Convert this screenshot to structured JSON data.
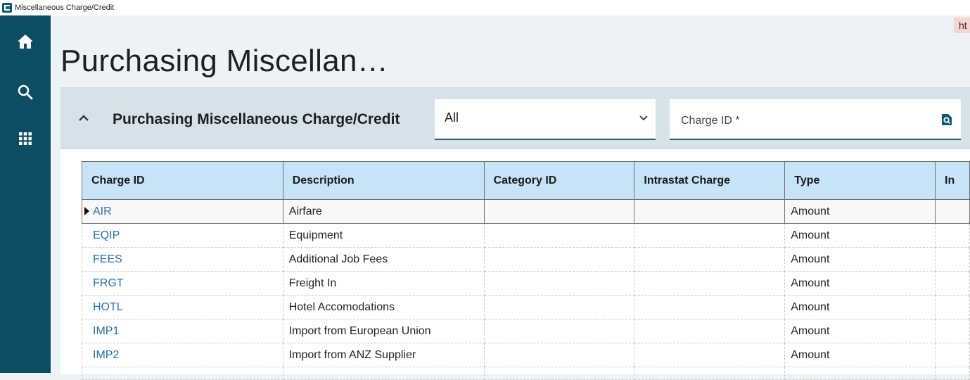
{
  "window": {
    "title": "Miscellaneous Charge/Credit"
  },
  "nav": {
    "items": [
      {
        "name": "home",
        "icon": "home-icon"
      },
      {
        "name": "search",
        "icon": "search-icon"
      },
      {
        "name": "apps",
        "icon": "apps-grid-icon"
      }
    ]
  },
  "url_chip": "ht",
  "page": {
    "title": "Purchasing Miscellan…"
  },
  "panel": {
    "title": "Purchasing Miscellaneous Charge/Credit",
    "filter": {
      "value": "All"
    },
    "search": {
      "placeholder": "Charge ID *"
    }
  },
  "grid": {
    "columns": [
      "Charge ID",
      "Description",
      "Category ID",
      "Intrastat Charge",
      "Type",
      "In"
    ],
    "rows": [
      {
        "id": "AIR",
        "description": "Airfare",
        "category": "",
        "intrastat": "",
        "type": "Amount"
      },
      {
        "id": "EQIP",
        "description": "Equipment",
        "category": "",
        "intrastat": "",
        "type": "Amount"
      },
      {
        "id": "FEES",
        "description": "Additional Job Fees",
        "category": "",
        "intrastat": "",
        "type": "Amount"
      },
      {
        "id": "FRGT",
        "description": "Freight In",
        "category": "",
        "intrastat": "",
        "type": "Amount"
      },
      {
        "id": "HOTL",
        "description": "Hotel Accomodations",
        "category": "",
        "intrastat": "",
        "type": "Amount"
      },
      {
        "id": "IMP1",
        "description": "Import from European Union",
        "category": "",
        "intrastat": "",
        "type": "Amount"
      },
      {
        "id": "IMP2",
        "description": "Import from ANZ Supplier",
        "category": "",
        "intrastat": "",
        "type": "Amount"
      }
    ]
  },
  "colors": {
    "nav": "#0c4d63",
    "header": "#d6e2e7",
    "grid_header": "#c6e3f7",
    "link": "#2a6fa8"
  }
}
